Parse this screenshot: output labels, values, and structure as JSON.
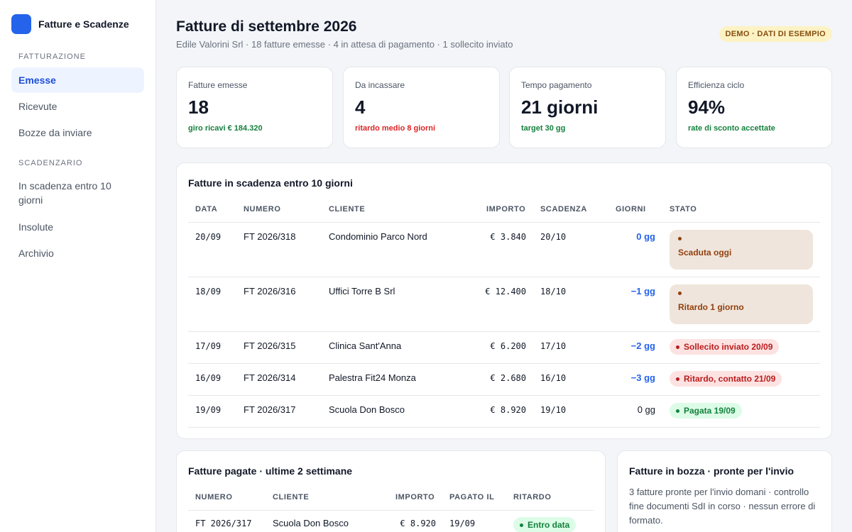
{
  "app": {
    "name": "Fatture e Scadenze"
  },
  "sidebar": {
    "sections": [
      {
        "label": "FATTURAZIONE",
        "items": [
          {
            "label": "Emesse",
            "active": true
          },
          {
            "label": "Ricevute"
          },
          {
            "label": "Bozze da inviare"
          }
        ]
      },
      {
        "label": "SCADENZARIO",
        "items": [
          {
            "label": "In scadenza entro 10 giorni"
          },
          {
            "label": "Insolute"
          },
          {
            "label": "Archivio"
          }
        ]
      }
    ]
  },
  "header": {
    "title": "Fatture di settembre 2026",
    "subtitle": "Edile Valorini Srl · 18 fatture emesse · 4 in attesa di pagamento · 1 sollecito inviato",
    "badge": "DEMO · DATI DI ESEMPIO"
  },
  "kpis": [
    {
      "label": "Fatture emesse",
      "value": "18",
      "note": "giro ricavi € 184.320",
      "tone": "green"
    },
    {
      "label": "Da incassare",
      "value": "4",
      "note": "ritardo medio 8 giorni",
      "tone": "red"
    },
    {
      "label": "Tempo pagamento",
      "value": "21 giorni",
      "note": "target 30 gg",
      "tone": "green"
    },
    {
      "label": "Efficienza ciclo",
      "value": "94%",
      "note": "rate di sconto accettate",
      "tone": "green"
    }
  ],
  "due_table": {
    "title": "Fatture in scadenza entro 10 giorni",
    "columns": [
      "DATA",
      "NUMERO",
      "CLIENTE",
      "IMPORTO",
      "SCADENZA",
      "GIORNI",
      "STATO"
    ],
    "rows": [
      {
        "data": "20/09",
        "numero": "FT 2026/318",
        "cliente": "Condominio Parco Nord",
        "importo": "€ 3.840",
        "scadenza": "20/10",
        "giorni": "0 gg",
        "stato": "Scaduta oggi",
        "stato_tone": "tan"
      },
      {
        "data": "18/09",
        "numero": "FT 2026/316",
        "cliente": "Uffici Torre B Srl",
        "importo": "€ 12.400",
        "scadenza": "18/10",
        "giorni": "−1 gg",
        "stato": "Ritardo 1 giorno",
        "stato_tone": "tan"
      },
      {
        "data": "17/09",
        "numero": "FT 2026/315",
        "cliente": "Clinica Sant'Anna",
        "importo": "€ 6.200",
        "scadenza": "17/10",
        "giorni": "−2 gg",
        "stato": "Sollecito inviato 20/09",
        "stato_tone": "red"
      },
      {
        "data": "16/09",
        "numero": "FT 2026/314",
        "cliente": "Palestra Fit24 Monza",
        "importo": "€ 2.680",
        "scadenza": "16/10",
        "giorni": "−3 gg",
        "stato": "Ritardo, contatto 21/09",
        "stato_tone": "red"
      },
      {
        "data": "19/09",
        "numero": "FT 2026/317",
        "cliente": "Scuola Don Bosco",
        "importo": "€ 8.920",
        "scadenza": "19/10",
        "giorni": "0 gg",
        "stato": "Pagata 19/09",
        "stato_tone": "green"
      }
    ]
  },
  "paid_table": {
    "title": "Fatture pagate · ultime 2 settimane",
    "columns": [
      "NUMERO",
      "CLIENTE",
      "IMPORTO",
      "PAGATO IL",
      "RITARDO"
    ],
    "rows": [
      {
        "numero": "FT 2026/317",
        "cliente": "Scuola Don Bosco",
        "importo": "€ 8.920",
        "pagato_il": "19/09",
        "ritardo": "Entro data"
      }
    ]
  },
  "drafts": {
    "title": "Fatture in bozza · pronte per l'invio",
    "text": "3 fatture pronte per l'invio domani · controllo fine documenti SdI in corso · nessun errore di formato."
  },
  "colors": {
    "accent": "#2563eb",
    "positive": "#15803d",
    "negative": "#dc2626",
    "warning_bg": "#efe5dc"
  }
}
